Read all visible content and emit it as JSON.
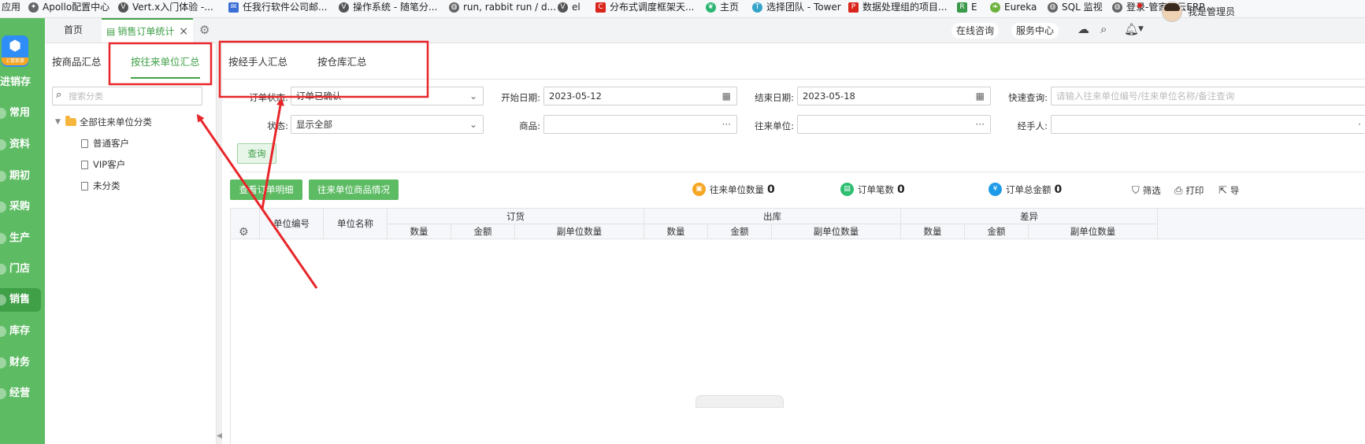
{
  "bookmarks": [
    {
      "label": "应用",
      "icon": "apps-grid-icon"
    },
    {
      "label": "Apollo配置中心",
      "icon": "apollo-icon"
    },
    {
      "label": "Vert.x入门体验 -...",
      "icon": "vertx-icon"
    },
    {
      "label": "任我行软件公司邮...",
      "icon": "mail-icon"
    },
    {
      "label": "操作系统 - 随笔分...",
      "icon": "vertx-icon"
    },
    {
      "label": "run, rabbit run / d...",
      "icon": "globe-icon"
    },
    {
      "label": "el",
      "icon": "vertx-icon"
    },
    {
      "label": "分布式调度框架天...",
      "icon": "csdn-icon"
    },
    {
      "label": "主页",
      "icon": "leaf-icon"
    },
    {
      "label": "选择团队 - Tower",
      "icon": "tower-icon"
    },
    {
      "label": "数据处理组的项目...",
      "icon": "project-icon"
    },
    {
      "label": "E",
      "icon": "e-icon"
    },
    {
      "label": "Eureka",
      "icon": "spring-icon"
    },
    {
      "label": "SQL 监视",
      "icon": "globe-icon"
    },
    {
      "label": "登录-管家婆云ERP...",
      "icon": "globe-icon"
    }
  ],
  "logo": {
    "sub": "上管家婆"
  },
  "main_nav": {
    "brand": "进销存",
    "items": [
      "常用",
      "资料",
      "期初",
      "采购",
      "生产",
      "门店",
      "销售",
      "库存",
      "财务",
      "经营"
    ],
    "active": "销售"
  },
  "tabs": {
    "home": "首页",
    "current": "销售订单统计",
    "close": "×"
  },
  "header": {
    "consult": "在线咨询",
    "service": "服务中心",
    "username": "我是管理员"
  },
  "sub_tabs": [
    "按商品汇总",
    "按往来单位汇总",
    "按经手人汇总",
    "按仓库汇总"
  ],
  "sub_tab_active": "按往来单位汇总",
  "tree": {
    "search_placeholder": "搜索分类",
    "root": "全部往来单位分类",
    "children": [
      "普通客户",
      "VIP客户",
      "未分类"
    ]
  },
  "filters": {
    "order_status_label": "订单状态:",
    "order_status_value": "订单已确认",
    "start_date_label": "开始日期:",
    "start_date": "2023-05-12",
    "end_date_label": "结束日期:",
    "end_date": "2023-05-18",
    "quick_query_label": "快速查询:",
    "quick_query_placeholder": "请输入往来单位编号/往来单位名称/备注查询",
    "status_label": "状态:",
    "status_value": "显示全部",
    "goods_label": "商品:",
    "partner_label": "往来单位:",
    "handler_label": "经手人:",
    "query_button": "查询"
  },
  "toolbar": {
    "detail_button": "查看订单明细",
    "partner_goods_button": "往来单位商品情况",
    "stats": [
      {
        "label": "往来单位数量",
        "value": "0",
        "color": "#f5a623",
        "icon": "partner-count-icon"
      },
      {
        "label": "订单笔数",
        "value": "0",
        "color": "#2fbf71",
        "icon": "order-count-icon"
      },
      {
        "label": "订单总金额",
        "value": "0",
        "color": "#1e9be8",
        "icon": "order-amount-icon"
      }
    ],
    "filter": "筛选",
    "print": "打印",
    "export": "导"
  },
  "table": {
    "unit_code": "单位编号",
    "unit_name": "单位名称",
    "groups": [
      "订货",
      "出库",
      "差异"
    ],
    "sub_columns": [
      "数量",
      "金额",
      "副单位数量"
    ]
  },
  "colors": {
    "accent": "#3fa047",
    "nav_bg": "#5dbb63",
    "annotation": "#e8262a"
  }
}
